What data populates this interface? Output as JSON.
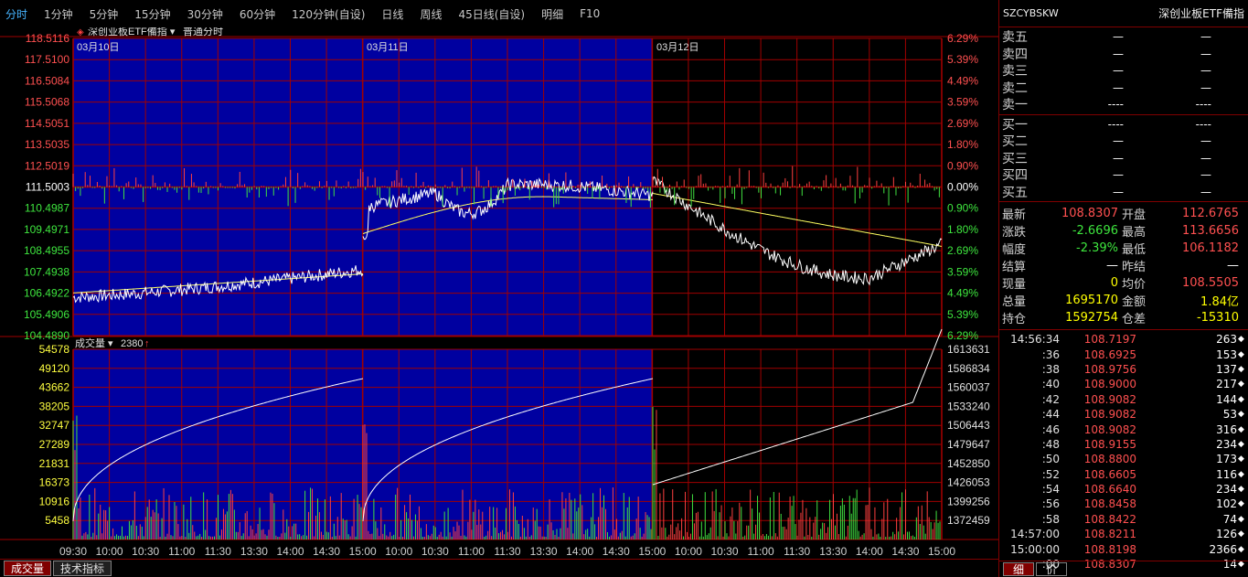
{
  "toolbar": {
    "items": [
      "分时",
      "1分钟",
      "5分钟",
      "15分钟",
      "30分钟",
      "60分钟",
      "120分钟(自设)",
      "日线",
      "周线",
      "45日线(自设)",
      "明细",
      "F10"
    ],
    "active_index": 0
  },
  "price_chart": {
    "title_name": "深创业板ETF備指",
    "title_mode": "普通分时",
    "day_labels": [
      "03月10日",
      "03月11日",
      "03月12日"
    ],
    "left_ticks": [
      "118.5116",
      "117.5100",
      "116.5084",
      "115.5068",
      "114.5051",
      "113.5035",
      "112.5019",
      "111.5003",
      "110.4987",
      "109.4971",
      "108.4955",
      "107.4938",
      "106.4922",
      "105.4906",
      "104.4890"
    ],
    "right_ticks": [
      "6.29%",
      "5.39%",
      "4.49%",
      "3.59%",
      "2.69%",
      "1.80%",
      "0.90%",
      "0.00%",
      "0.90%",
      "1.80%",
      "2.69%",
      "3.59%",
      "4.49%",
      "5.39%",
      "6.29%"
    ],
    "price_range": [
      104.489,
      118.5116
    ],
    "base_price": 111.5003
  },
  "volume_chart": {
    "title": "成交量",
    "value": "2380",
    "left_ticks": [
      "54578",
      "49120",
      "43662",
      "38205",
      "32747",
      "27289",
      "21831",
      "16373",
      "10916",
      "5458"
    ],
    "right_ticks": [
      "1613631",
      "1586834",
      "1560037",
      "1533240",
      "1506443",
      "1479647",
      "1452850",
      "1426053",
      "1399256",
      "1372459"
    ]
  },
  "time_axis": [
    "09:30",
    "10:00",
    "10:30",
    "11:00",
    "11:30",
    "13:30",
    "14:00",
    "14:30",
    "15:00",
    "10:00",
    "10:30",
    "11:00",
    "11:30",
    "13:30",
    "14:00",
    "14:30",
    "15:00",
    "10:00",
    "10:30",
    "11:00",
    "11:30",
    "13:30",
    "14:00",
    "14:30",
    "15:00"
  ],
  "bottom_tabs": [
    "成交量",
    "技术指标"
  ],
  "panel": {
    "code": "SZCYBSKW",
    "name": "深创业板ETF備指",
    "sell": [
      {
        "label": "卖五",
        "price": "—",
        "vol": "—"
      },
      {
        "label": "卖四",
        "price": "—",
        "vol": "—"
      },
      {
        "label": "卖三",
        "price": "—",
        "vol": "—"
      },
      {
        "label": "卖二",
        "price": "—",
        "vol": "—"
      },
      {
        "label": "卖一",
        "price": "----",
        "vol": "----"
      }
    ],
    "buy": [
      {
        "label": "买一",
        "price": "----",
        "vol": "----"
      },
      {
        "label": "买二",
        "price": "—",
        "vol": "—"
      },
      {
        "label": "买三",
        "price": "—",
        "vol": "—"
      },
      {
        "label": "买四",
        "price": "—",
        "vol": "—"
      },
      {
        "label": "买五",
        "price": "—",
        "vol": "—"
      }
    ],
    "stats": [
      {
        "l": "最新",
        "v": "108.8307",
        "c": "red",
        "l2": "开盘",
        "v2": "112.6765",
        "c2": "red"
      },
      {
        "l": "涨跌",
        "v": "-2.6696",
        "c": "green",
        "l2": "最高",
        "v2": "113.6656",
        "c2": "red"
      },
      {
        "l": "幅度",
        "v": "-2.39%",
        "c": "green",
        "l2": "最低",
        "v2": "106.1182",
        "c2": "red"
      },
      {
        "l": "结算",
        "v": "—",
        "c": "white",
        "l2": "昨结",
        "v2": "—",
        "c2": "white"
      },
      {
        "l": "现量",
        "v": "0",
        "c": "yellow",
        "l2": "均价",
        "v2": "108.5505",
        "c2": "red"
      },
      {
        "l": "总量",
        "v": "1695170",
        "c": "yellow",
        "l2": "金额",
        "v2": "1.84亿",
        "c2": "yellow"
      },
      {
        "l": "持仓",
        "v": "1592754",
        "c": "yellow",
        "l2": "仓差",
        "v2": "-15310",
        "c2": "yellow"
      }
    ],
    "ticks": [
      {
        "t": "14:56:34",
        "p": "108.7197",
        "q": "263"
      },
      {
        "t": ":36",
        "p": "108.6925",
        "q": "153"
      },
      {
        "t": ":38",
        "p": "108.9756",
        "q": "137"
      },
      {
        "t": ":40",
        "p": "108.9000",
        "q": "217"
      },
      {
        "t": ":42",
        "p": "108.9082",
        "q": "144"
      },
      {
        "t": ":44",
        "p": "108.9082",
        "q": "53"
      },
      {
        "t": ":46",
        "p": "108.9082",
        "q": "316"
      },
      {
        "t": ":48",
        "p": "108.9155",
        "q": "234"
      },
      {
        "t": ":50",
        "p": "108.8800",
        "q": "173"
      },
      {
        "t": ":52",
        "p": "108.6605",
        "q": "116"
      },
      {
        "t": ":54",
        "p": "108.6640",
        "q": "234"
      },
      {
        "t": ":56",
        "p": "108.8458",
        "q": "102"
      },
      {
        "t": ":58",
        "p": "108.8422",
        "q": "74"
      },
      {
        "t": "14:57:00",
        "p": "108.8211",
        "q": "126"
      },
      {
        "t": "15:00:00",
        "p": "108.8198",
        "q": "2366"
      },
      {
        "t": ":00",
        "p": "108.8307",
        "q": "14"
      }
    ],
    "tabs": [
      "细",
      "价"
    ]
  },
  "colors": {
    "blue_bg": "#0000a0",
    "grid": "#a00000",
    "up": "#ff4040",
    "down": "#40e040",
    "price_line": "#ffffff",
    "avg_line": "#ffff60",
    "accent_tab": "#46b4ff"
  }
}
